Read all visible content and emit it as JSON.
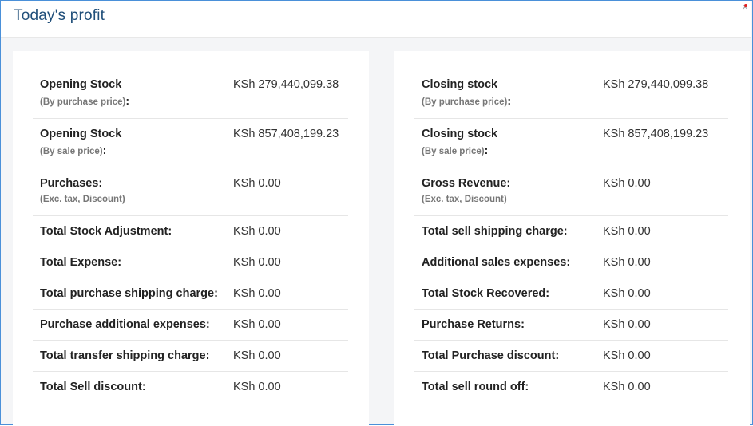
{
  "modal": {
    "title": "Today's profit",
    "close_glyph": "×"
  },
  "left_rows": [
    {
      "label": "Opening Stock",
      "sub": "(By purchase price)",
      "colon": ":",
      "value": "KSh 279,440,099.38"
    },
    {
      "label": "Opening Stock",
      "sub": "(By sale price)",
      "colon": ":",
      "value": "KSh 857,408,199.23"
    },
    {
      "label": "Purchases:",
      "sub": "(Exc. tax, Discount)",
      "colon": "",
      "value": "KSh 0.00"
    },
    {
      "label": "Total Stock Adjustment:",
      "value": "KSh 0.00"
    },
    {
      "label": "Total Expense:",
      "value": "KSh 0.00"
    },
    {
      "label": "Total purchase shipping charge:",
      "value": "KSh 0.00"
    },
    {
      "label": "Purchase additional expenses:",
      "value": "KSh 0.00"
    },
    {
      "label": "Total transfer shipping charge:",
      "value": "KSh 0.00"
    },
    {
      "label": "Total Sell discount:",
      "value": "KSh 0.00"
    }
  ],
  "right_rows": [
    {
      "label": "Closing stock",
      "sub": "(By purchase price)",
      "colon": ":",
      "value": "KSh 279,440,099.38"
    },
    {
      "label": "Closing stock",
      "sub": "(By sale price)",
      "colon": ":",
      "value": "KSh 857,408,199.23"
    },
    {
      "label": "Gross Revenue:",
      "sub": "(Exc. tax, Discount)",
      "colon": "",
      "value": "KSh 0.00"
    },
    {
      "label": "Total sell shipping charge:",
      "value": "KSh 0.00"
    },
    {
      "label": "Additional sales expenses:",
      "value": "KSh 0.00"
    },
    {
      "label": "Total Stock Recovered:",
      "value": "KSh 0.00"
    },
    {
      "label": "Purchase Returns:",
      "value": "KSh 0.00"
    },
    {
      "label": "Total Purchase discount:",
      "value": "KSh 0.00"
    },
    {
      "label": "Total sell round off:",
      "value": "KSh 0.00"
    }
  ]
}
